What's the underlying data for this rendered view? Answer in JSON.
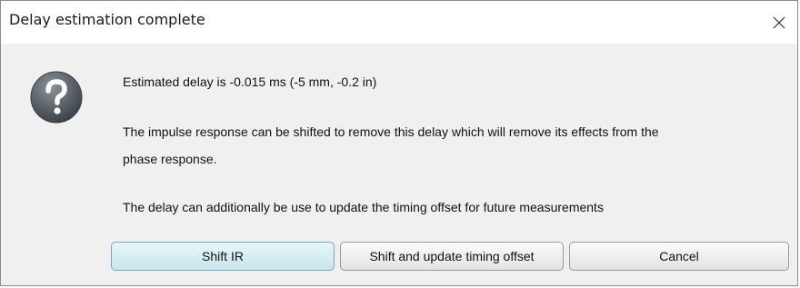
{
  "window": {
    "title": "Delay estimation complete",
    "close_icon": "close-icon"
  },
  "dialog": {
    "icon": "question-icon",
    "icon_color": "#5a6369",
    "messages": [
      "Estimated delay is -0.015 ms (-5 mm, -0.2 in)",
      "The impulse response can be shifted to remove this delay which will remove its effects from the",
      "phase response.",
      "The delay can additionally be use to update the timing offset for future measurements"
    ]
  },
  "buttons": {
    "shift_ir": "Shift IR",
    "shift_update": "Shift and update timing offset",
    "cancel": "Cancel"
  },
  "colors": {
    "default_button_fill": "#c6e6ec",
    "content_background": "#f0f0f0",
    "titlebar_background": "#ffffff"
  }
}
